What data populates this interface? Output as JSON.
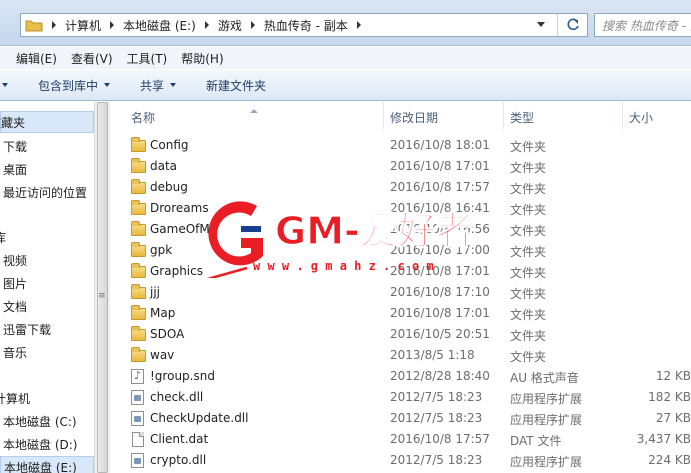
{
  "address": {
    "crumbs": [
      "计算机",
      "本地磁盘 (E:)",
      "游戏",
      "热血传奇 - 副本"
    ],
    "search_placeholder": "搜索 热血传奇 - 副本"
  },
  "menu": [
    "编辑(E)",
    "查看(V)",
    "工具(T)",
    "帮助(H)"
  ],
  "toolbar": {
    "include_library": "包含到库中",
    "share": "共享",
    "new_folder": "新建文件夹"
  },
  "nav": {
    "favorites": "收藏夹",
    "downloads": "下载",
    "desktop": "桌面",
    "recent": "最近访问的位置",
    "libraries": "库",
    "videos": "视频",
    "pictures": "图片",
    "documents": "文档",
    "thunder": "迅雷下载",
    "music": "音乐",
    "computer": "计算机",
    "drive_c": "本地磁盘 (C:)",
    "drive_d": "本地磁盘 (D:)",
    "drive_e": "本地磁盘 (E:)"
  },
  "columns": {
    "name": "名称",
    "date": "修改日期",
    "type": "类型",
    "size": "大小"
  },
  "files": [
    {
      "name": "Config",
      "date": "2016/10/8 18:01",
      "type": "文件夹",
      "size": "",
      "icon": "folder-icon"
    },
    {
      "name": "data",
      "date": "2016/10/8 17:01",
      "type": "文件夹",
      "size": "",
      "icon": "folder-icon"
    },
    {
      "name": "debug",
      "date": "2016/10/8 17:57",
      "type": "文件夹",
      "size": "",
      "icon": "folder-icon"
    },
    {
      "name": "Droreams",
      "date": "2016/10/8 16:41",
      "type": "文件夹",
      "size": "",
      "icon": "folder-icon"
    },
    {
      "name": "GameOfMir",
      "date": "2016/10/8 16:56",
      "type": "文件夹",
      "size": "",
      "icon": "folder-icon"
    },
    {
      "name": "gpk",
      "date": "2016/10/8 17:00",
      "type": "文件夹",
      "size": "",
      "icon": "folder-icon"
    },
    {
      "name": "Graphics",
      "date": "2016/10/8 17:01",
      "type": "文件夹",
      "size": "",
      "icon": "folder-icon"
    },
    {
      "name": "jjj",
      "date": "2016/10/8 17:10",
      "type": "文件夹",
      "size": "",
      "icon": "folder-icon"
    },
    {
      "name": "Map",
      "date": "2016/10/8 17:01",
      "type": "文件夹",
      "size": "",
      "icon": "folder-icon"
    },
    {
      "name": "SDOA",
      "date": "2016/10/5 20:51",
      "type": "文件夹",
      "size": "",
      "icon": "folder-icon"
    },
    {
      "name": "wav",
      "date": "2013/8/5 1:18",
      "type": "文件夹",
      "size": "",
      "icon": "folder-icon"
    },
    {
      "name": "!group.snd",
      "date": "2012/8/28 18:40",
      "type": "AU 格式声音",
      "size": "12 KB",
      "icon": "sound-file-icon"
    },
    {
      "name": "check.dll",
      "date": "2012/7/5 18:23",
      "type": "应用程序扩展",
      "size": "182 KB",
      "icon": "dll-file-icon"
    },
    {
      "name": "CheckUpdate.dll",
      "date": "2012/7/5 18:23",
      "type": "应用程序扩展",
      "size": "27 KB",
      "icon": "dll-file-icon"
    },
    {
      "name": "Client.dat",
      "date": "2016/10/8 17:57",
      "type": "DAT 文件",
      "size": "3,437 KB",
      "icon": "file-icon"
    },
    {
      "name": "crypto.dll",
      "date": "2012/7/5 18:23",
      "type": "应用程序扩展",
      "size": "224 KB",
      "icon": "dll-file-icon"
    }
  ],
  "watermark": {
    "text": "GM-爱好者",
    "url": "w w w . g m a h z . c o m"
  }
}
